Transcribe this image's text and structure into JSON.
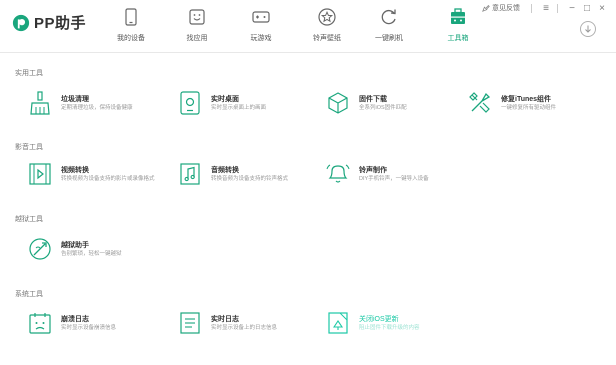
{
  "app": {
    "logo_text": "PP助手",
    "brand_color": "#1aa67d"
  },
  "nav": [
    {
      "label": "我的设备",
      "icon": "phone-icon"
    },
    {
      "label": "找应用",
      "icon": "smile-icon"
    },
    {
      "label": "玩游戏",
      "icon": "gamepad-icon"
    },
    {
      "label": "铃声壁纸",
      "icon": "star-icon"
    },
    {
      "label": "一键刷机",
      "icon": "refresh-icon"
    },
    {
      "label": "工具箱",
      "icon": "toolbox-icon",
      "active": true
    }
  ],
  "window": {
    "feedback_label": "意见反馈",
    "menu": "≡",
    "minimize": "−",
    "maximize": "□",
    "close": "×"
  },
  "sections": [
    {
      "title": "实用工具",
      "tools": [
        {
          "name": "垃圾清理",
          "desc": "定期清理垃圾，保持设备健康",
          "icon": "broom-icon"
        },
        {
          "name": "实时桌面",
          "desc": "实时显示桌面上的画面",
          "icon": "screen-icon"
        },
        {
          "name": "固件下载",
          "desc": "全系列iOS固件匹配",
          "icon": "cube-icon"
        },
        {
          "name": "修复iTunes组件",
          "desc": "一键修复所有驱动组件",
          "icon": "wrench-icon"
        }
      ]
    },
    {
      "title": "影音工具",
      "tools": [
        {
          "name": "视频转换",
          "desc": "转换视频为设备支持的影片或录像格式",
          "icon": "video-icon"
        },
        {
          "name": "音频转换",
          "desc": "转换音频为设备支持的铃声格式",
          "icon": "audio-icon"
        },
        {
          "name": "铃声制作",
          "desc": "DIY手机铃声，一键导入设备",
          "icon": "bell-icon"
        }
      ]
    },
    {
      "title": "越狱工具",
      "tools": [
        {
          "name": "越狱助手",
          "desc": "告别繁琐，轻松一键越狱",
          "icon": "jailbreak-icon"
        }
      ]
    },
    {
      "title": "系统工具",
      "tools": [
        {
          "name": "崩溃日志",
          "desc": "实时显示设备崩溃信息",
          "icon": "crash-log-icon"
        },
        {
          "name": "实时日志",
          "desc": "实时显示设备上的日志信息",
          "icon": "log-icon"
        },
        {
          "name": "关闭iOS更新",
          "desc": "阻止固件下载升级的内容",
          "icon": "ios-update-icon",
          "highlight": true
        }
      ]
    }
  ]
}
